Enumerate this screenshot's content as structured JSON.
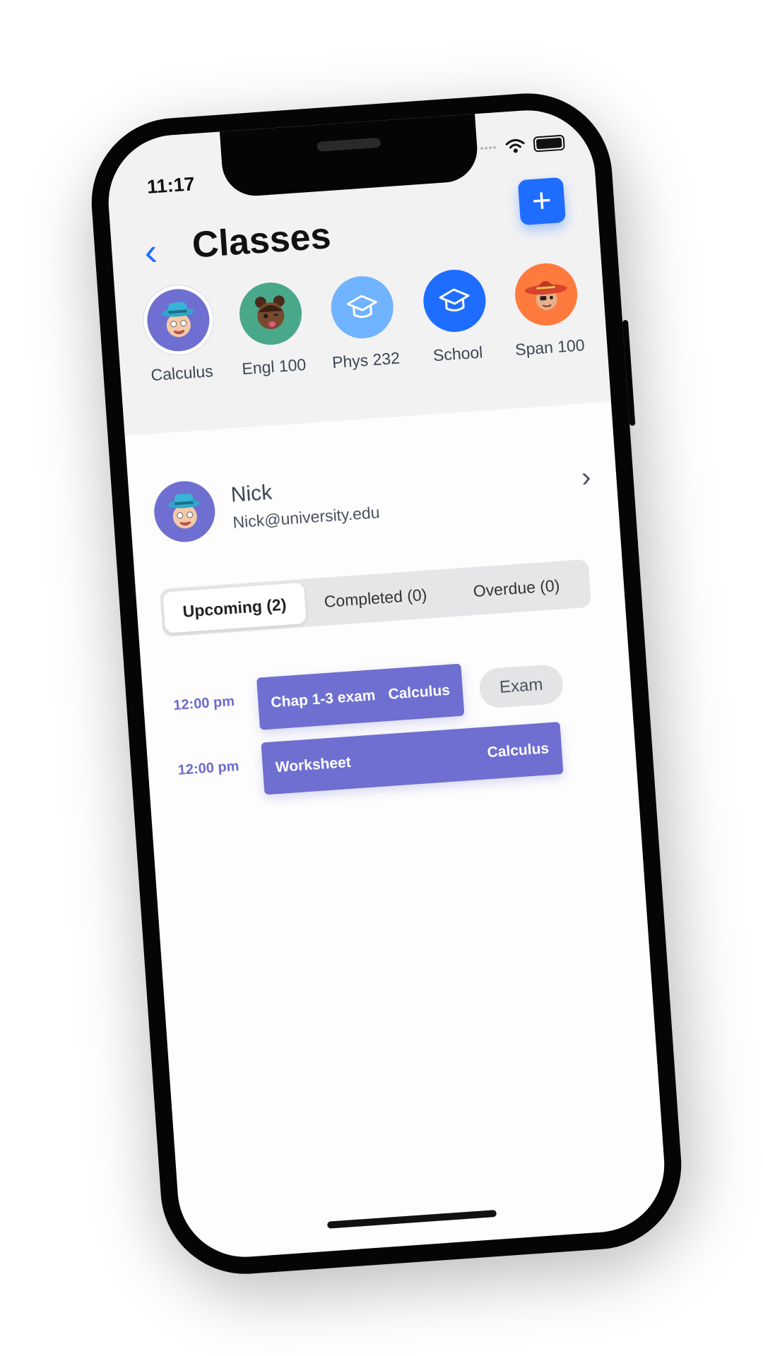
{
  "status_bar": {
    "time": "11:17",
    "signal": "••••"
  },
  "header": {
    "title": "Classes",
    "back_label": "‹",
    "add_label": "+"
  },
  "classes": [
    {
      "label": "Calculus",
      "icon": "memoji-hat",
      "color": "#6f6fd1",
      "selected": true
    },
    {
      "label": "Engl 100",
      "icon": "memoji-girl",
      "color": "#4aa88a",
      "selected": false
    },
    {
      "label": "Phys 232",
      "icon": "graduation-cap-icon",
      "color": "#70b3ff",
      "selected": false
    },
    {
      "label": "School",
      "icon": "graduation-cap-icon",
      "color": "#1f6dff",
      "selected": false
    },
    {
      "label": "Span 100",
      "icon": "memoji-sombrero",
      "color": "#ff7a3d",
      "selected": false
    }
  ],
  "profile": {
    "name": "Nick",
    "email": "Nick@university.edu",
    "chevron": "›"
  },
  "tabs": [
    {
      "label": "Upcoming (2)",
      "active": true
    },
    {
      "label": "Completed (0)",
      "active": false
    },
    {
      "label": "Overdue (0)",
      "active": false
    }
  ],
  "tasks": [
    {
      "time": "12:00 pm",
      "title": "Chap 1-3 exam",
      "class": "Calculus",
      "tag": "Exam"
    },
    {
      "time": "12:00 pm",
      "title": "Worksheet",
      "class": "Calculus",
      "tag": ""
    }
  ],
  "colors": {
    "accent": "#1f6dff",
    "task": "#6f6fd1"
  }
}
